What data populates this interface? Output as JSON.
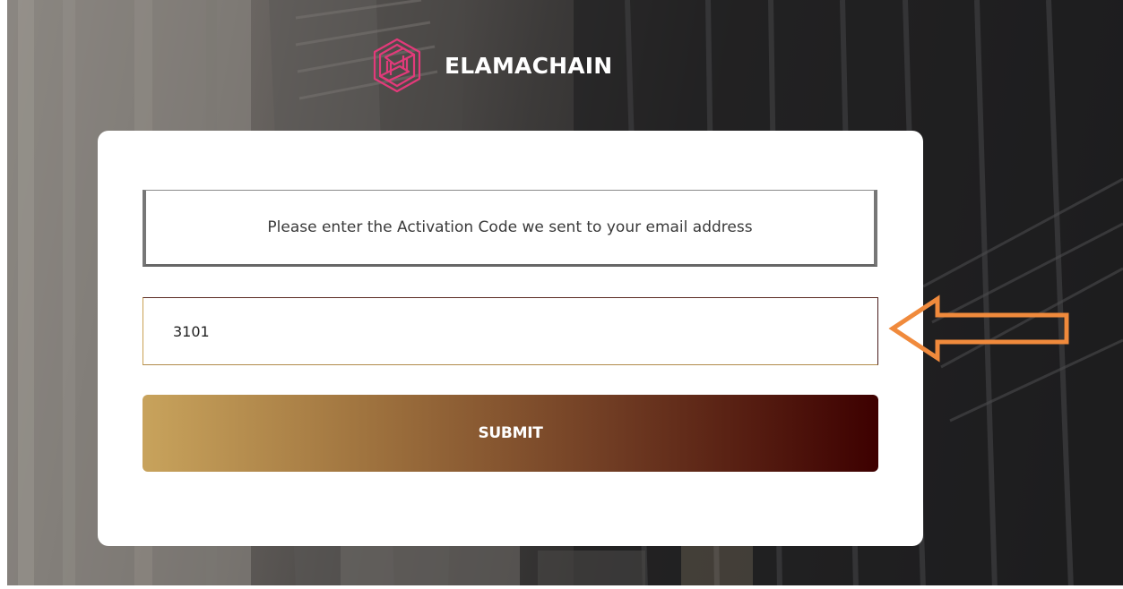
{
  "brand": {
    "name": "ELAMACHAIN",
    "logo_color": "#e23a7a"
  },
  "activation": {
    "message": "Please enter the Activation Code we sent to your email address",
    "code_value": "3101",
    "submit_label": "SUBMIT"
  },
  "annotation": {
    "arrow_color": "#f08a3c"
  },
  "colors": {
    "button_gradient_start": "#c8a35c",
    "button_gradient_end": "#3d0000",
    "card_background": "#ffffff"
  }
}
